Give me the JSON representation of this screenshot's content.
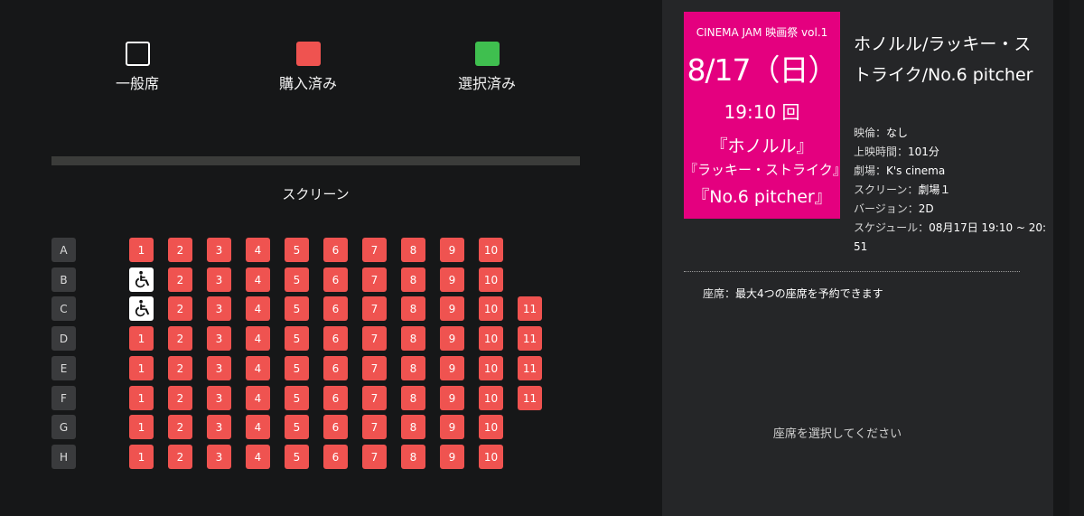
{
  "legend": {
    "general": "一般席",
    "purchased": "購入済み",
    "selected": "選択済み"
  },
  "screen_label": "スクリーン",
  "seat_map": [
    {
      "row": "A",
      "seats": [
        "1",
        "2",
        "3",
        "4",
        "5",
        "6",
        "7",
        "8",
        "9",
        "10"
      ]
    },
    {
      "row": "B",
      "seats": [
        "wheelchair",
        "2",
        "3",
        "4",
        "5",
        "6",
        "7",
        "8",
        "9",
        "10"
      ]
    },
    {
      "row": "C",
      "seats": [
        "wheelchair",
        "2",
        "3",
        "4",
        "5",
        "6",
        "7",
        "8",
        "9",
        "10",
        "11"
      ]
    },
    {
      "row": "D",
      "seats": [
        "1",
        "2",
        "3",
        "4",
        "5",
        "6",
        "7",
        "8",
        "9",
        "10",
        "11"
      ]
    },
    {
      "row": "E",
      "seats": [
        "1",
        "2",
        "3",
        "4",
        "5",
        "6",
        "7",
        "8",
        "9",
        "10",
        "11"
      ]
    },
    {
      "row": "F",
      "seats": [
        "1",
        "2",
        "3",
        "4",
        "5",
        "6",
        "7",
        "8",
        "9",
        "10",
        "11"
      ]
    },
    {
      "row": "G",
      "seats": [
        "1",
        "2",
        "3",
        "4",
        "5",
        "6",
        "7",
        "8",
        "9",
        "10"
      ]
    },
    {
      "row": "H",
      "seats": [
        "1",
        "2",
        "3",
        "4",
        "5",
        "6",
        "7",
        "8",
        "9",
        "10"
      ]
    }
  ],
  "seat_status": "purchased",
  "poster": {
    "event": "CINEMA JAM 映画祭 vol.1",
    "date": "8/17（日）",
    "time": "19:10 回",
    "title_line1": "『ホノルル』",
    "title_line2": "『ラッキー・ストライク』",
    "title_line3": "『No.6 pitcher』"
  },
  "movie": {
    "title": "ホノルル/ラッキー・ストライク/No.6 pitcher",
    "rating_label": "映倫：",
    "rating_value": "なし",
    "runtime_label": "上映時間：",
    "runtime_value": "101分",
    "theater_label": "劇場：",
    "theater_value": "K's cinema",
    "screen_label": "スクリーン：",
    "screen_value": "劇場１",
    "version_label": "バージョン：",
    "version_value": "2D",
    "schedule_label": "スケジュール：",
    "schedule_value": "08月17日 19:10 ~ 20:51"
  },
  "seat_note": {
    "label": "座席：",
    "value": "最大4つの座席を予約できます"
  },
  "select_message": "座席を選択してください",
  "colors": {
    "purchased": "#ef5350",
    "selected": "#3fbf4f",
    "poster": "#e4007f"
  }
}
